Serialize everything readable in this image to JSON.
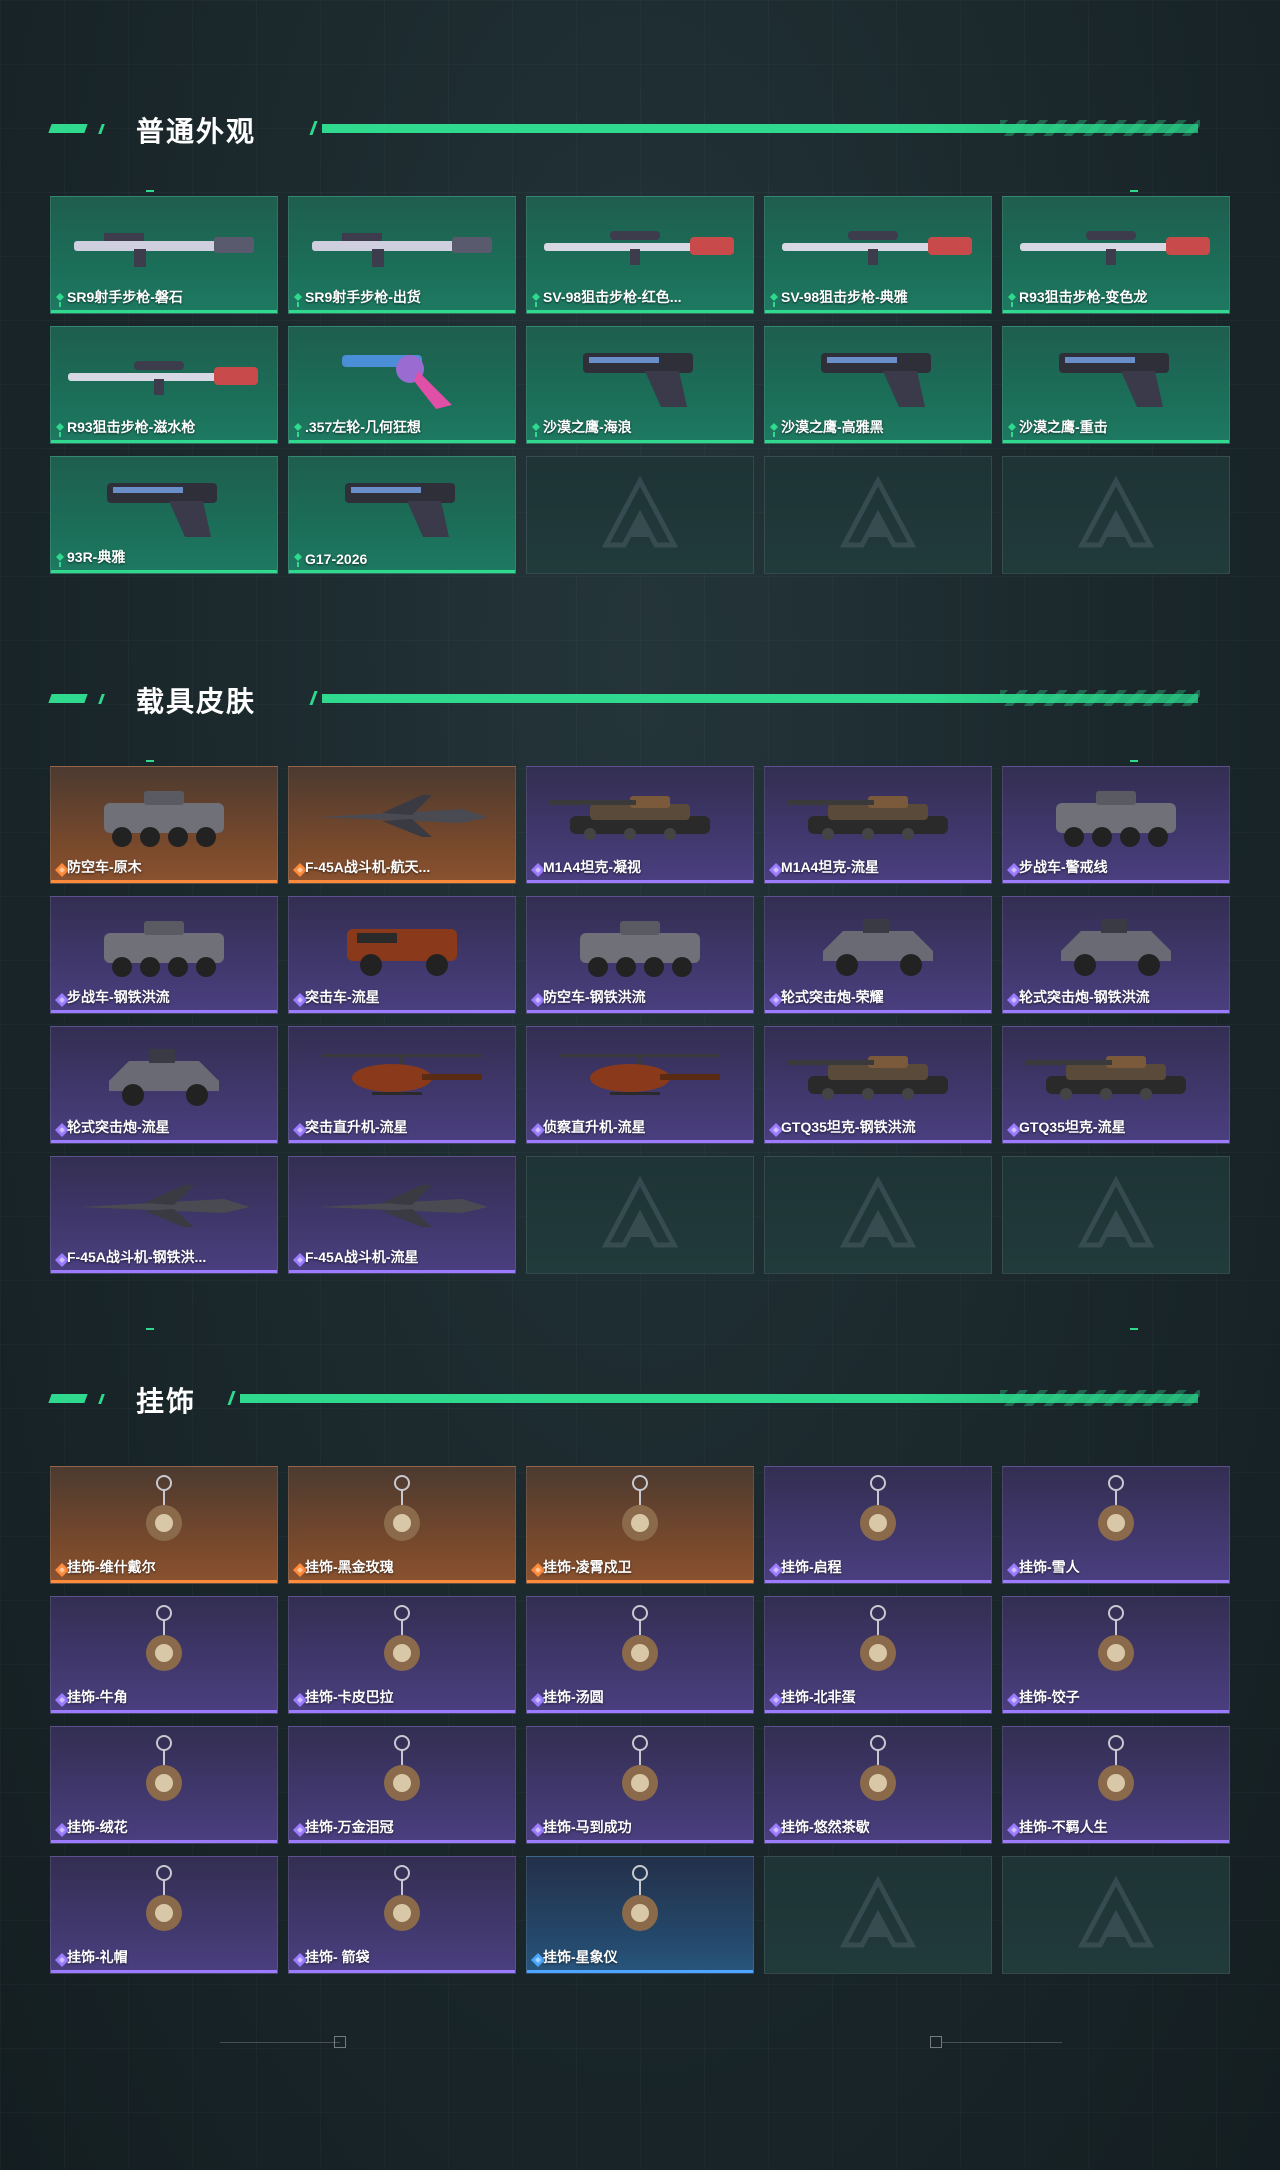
{
  "sections": [
    {
      "title": "普通外观",
      "items": [
        {
          "label": "SR9射手步枪-磐石",
          "rarity": "green",
          "icon": "rifle-icon"
        },
        {
          "label": "SR9射手步枪-出货",
          "rarity": "green",
          "icon": "rifle-icon"
        },
        {
          "label": "SV-98狙击步枪-红色...",
          "rarity": "green",
          "icon": "sniper-icon"
        },
        {
          "label": "SV-98狙击步枪-典雅",
          "rarity": "green",
          "icon": "sniper-icon"
        },
        {
          "label": "R93狙击步枪-变色龙",
          "rarity": "green",
          "icon": "sniper-icon"
        },
        {
          "label": "R93狙击步枪-滋水枪",
          "rarity": "green",
          "icon": "sniper-icon"
        },
        {
          "label": ".357左轮-几何狂想",
          "rarity": "green",
          "icon": "revolver-icon"
        },
        {
          "label": "沙漠之鹰-海浪",
          "rarity": "green",
          "icon": "pistol-icon"
        },
        {
          "label": "沙漠之鹰-高雅黑",
          "rarity": "green",
          "icon": "pistol-icon"
        },
        {
          "label": "沙漠之鹰-重击",
          "rarity": "green",
          "icon": "pistol-icon"
        },
        {
          "label": "93R-典雅",
          "rarity": "green",
          "icon": "pistol-icon"
        },
        {
          "label": "G17-2026",
          "rarity": "green",
          "icon": "pistol-icon"
        },
        {
          "label": "",
          "rarity": "empty",
          "icon": "placeholder-icon"
        },
        {
          "label": "",
          "rarity": "empty",
          "icon": "placeholder-icon"
        },
        {
          "label": "",
          "rarity": "empty",
          "icon": "placeholder-icon"
        }
      ]
    },
    {
      "title": "载具皮肤",
      "items": [
        {
          "label": "防空车-原木",
          "rarity": "orange",
          "icon": "apc-icon"
        },
        {
          "label": "F-45A战斗机-航天...",
          "rarity": "orange",
          "icon": "jet-icon"
        },
        {
          "label": "M1A4坦克-凝视",
          "rarity": "purple",
          "icon": "tank-icon"
        },
        {
          "label": "M1A4坦克-流星",
          "rarity": "purple",
          "icon": "tank-icon"
        },
        {
          "label": "步战车-警戒线",
          "rarity": "purple",
          "icon": "apc-icon"
        },
        {
          "label": "步战车-钢铁洪流",
          "rarity": "purple",
          "icon": "apc-icon"
        },
        {
          "label": "突击车-流星",
          "rarity": "purple",
          "icon": "truck-icon"
        },
        {
          "label": "防空车-钢铁洪流",
          "rarity": "purple",
          "icon": "apc-icon"
        },
        {
          "label": "轮式突击炮-荣耀",
          "rarity": "purple",
          "icon": "armored-car-icon"
        },
        {
          "label": "轮式突击炮-钢铁洪流",
          "rarity": "purple",
          "icon": "armored-car-icon"
        },
        {
          "label": "轮式突击炮-流星",
          "rarity": "purple",
          "icon": "armored-car-icon"
        },
        {
          "label": "突击直升机-流星",
          "rarity": "purple",
          "icon": "helicopter-icon"
        },
        {
          "label": "侦察直升机-流星",
          "rarity": "purple",
          "icon": "helicopter-icon"
        },
        {
          "label": "GTQ35坦克-钢铁洪流",
          "rarity": "purple",
          "icon": "tank-icon"
        },
        {
          "label": "GTQ35坦克-流星",
          "rarity": "purple",
          "icon": "tank-icon"
        },
        {
          "label": "F-45A战斗机-钢铁洪...",
          "rarity": "purple",
          "icon": "jet-icon"
        },
        {
          "label": "F-45A战斗机-流星",
          "rarity": "purple",
          "icon": "jet-icon"
        },
        {
          "label": "",
          "rarity": "empty",
          "icon": "placeholder-icon"
        },
        {
          "label": "",
          "rarity": "empty",
          "icon": "placeholder-icon"
        },
        {
          "label": "",
          "rarity": "empty",
          "icon": "placeholder-icon"
        }
      ]
    },
    {
      "title": "挂饰",
      "items": [
        {
          "label": "挂饰-维什戴尔",
          "rarity": "orange",
          "icon": "charm-icon"
        },
        {
          "label": "挂饰-黑金玫瑰",
          "rarity": "orange",
          "icon": "charm-icon"
        },
        {
          "label": "挂饰-凌霄戍卫",
          "rarity": "orange",
          "icon": "charm-icon"
        },
        {
          "label": "挂饰-启程",
          "rarity": "purple",
          "icon": "charm-icon"
        },
        {
          "label": "挂饰-雪人",
          "rarity": "purple",
          "icon": "charm-icon"
        },
        {
          "label": "挂饰-牛角",
          "rarity": "purple",
          "icon": "charm-icon"
        },
        {
          "label": "挂饰-卡皮巴拉",
          "rarity": "purple",
          "icon": "charm-icon"
        },
        {
          "label": "挂饰-汤圆",
          "rarity": "purple",
          "icon": "charm-icon"
        },
        {
          "label": "挂饰-北非蛋",
          "rarity": "purple",
          "icon": "charm-icon"
        },
        {
          "label": "挂饰-饺子",
          "rarity": "purple",
          "icon": "charm-icon"
        },
        {
          "label": "挂饰-绒花",
          "rarity": "purple",
          "icon": "charm-icon"
        },
        {
          "label": "挂饰-万金泪冠",
          "rarity": "purple",
          "icon": "charm-icon"
        },
        {
          "label": "挂饰-马到成功",
          "rarity": "purple",
          "icon": "charm-icon"
        },
        {
          "label": "挂饰-悠然茶歇",
          "rarity": "purple",
          "icon": "charm-icon"
        },
        {
          "label": "挂饰-不羁人生",
          "rarity": "purple",
          "icon": "charm-icon"
        },
        {
          "label": "挂饰-礼帽",
          "rarity": "purple",
          "icon": "charm-icon"
        },
        {
          "label": "挂饰- 箭袋",
          "rarity": "purple",
          "icon": "charm-icon"
        },
        {
          "label": "挂饰-星象仪",
          "rarity": "blue",
          "icon": "charm-icon"
        },
        {
          "label": "",
          "rarity": "empty",
          "icon": "placeholder-icon"
        },
        {
          "label": "",
          "rarity": "empty",
          "icon": "placeholder-icon"
        }
      ]
    }
  ],
  "colors": {
    "accent": "#2fd98e",
    "green": "#2fd98e",
    "orange": "#ff8a3a",
    "purple": "#9b7bff",
    "blue": "#4aa6ff"
  }
}
